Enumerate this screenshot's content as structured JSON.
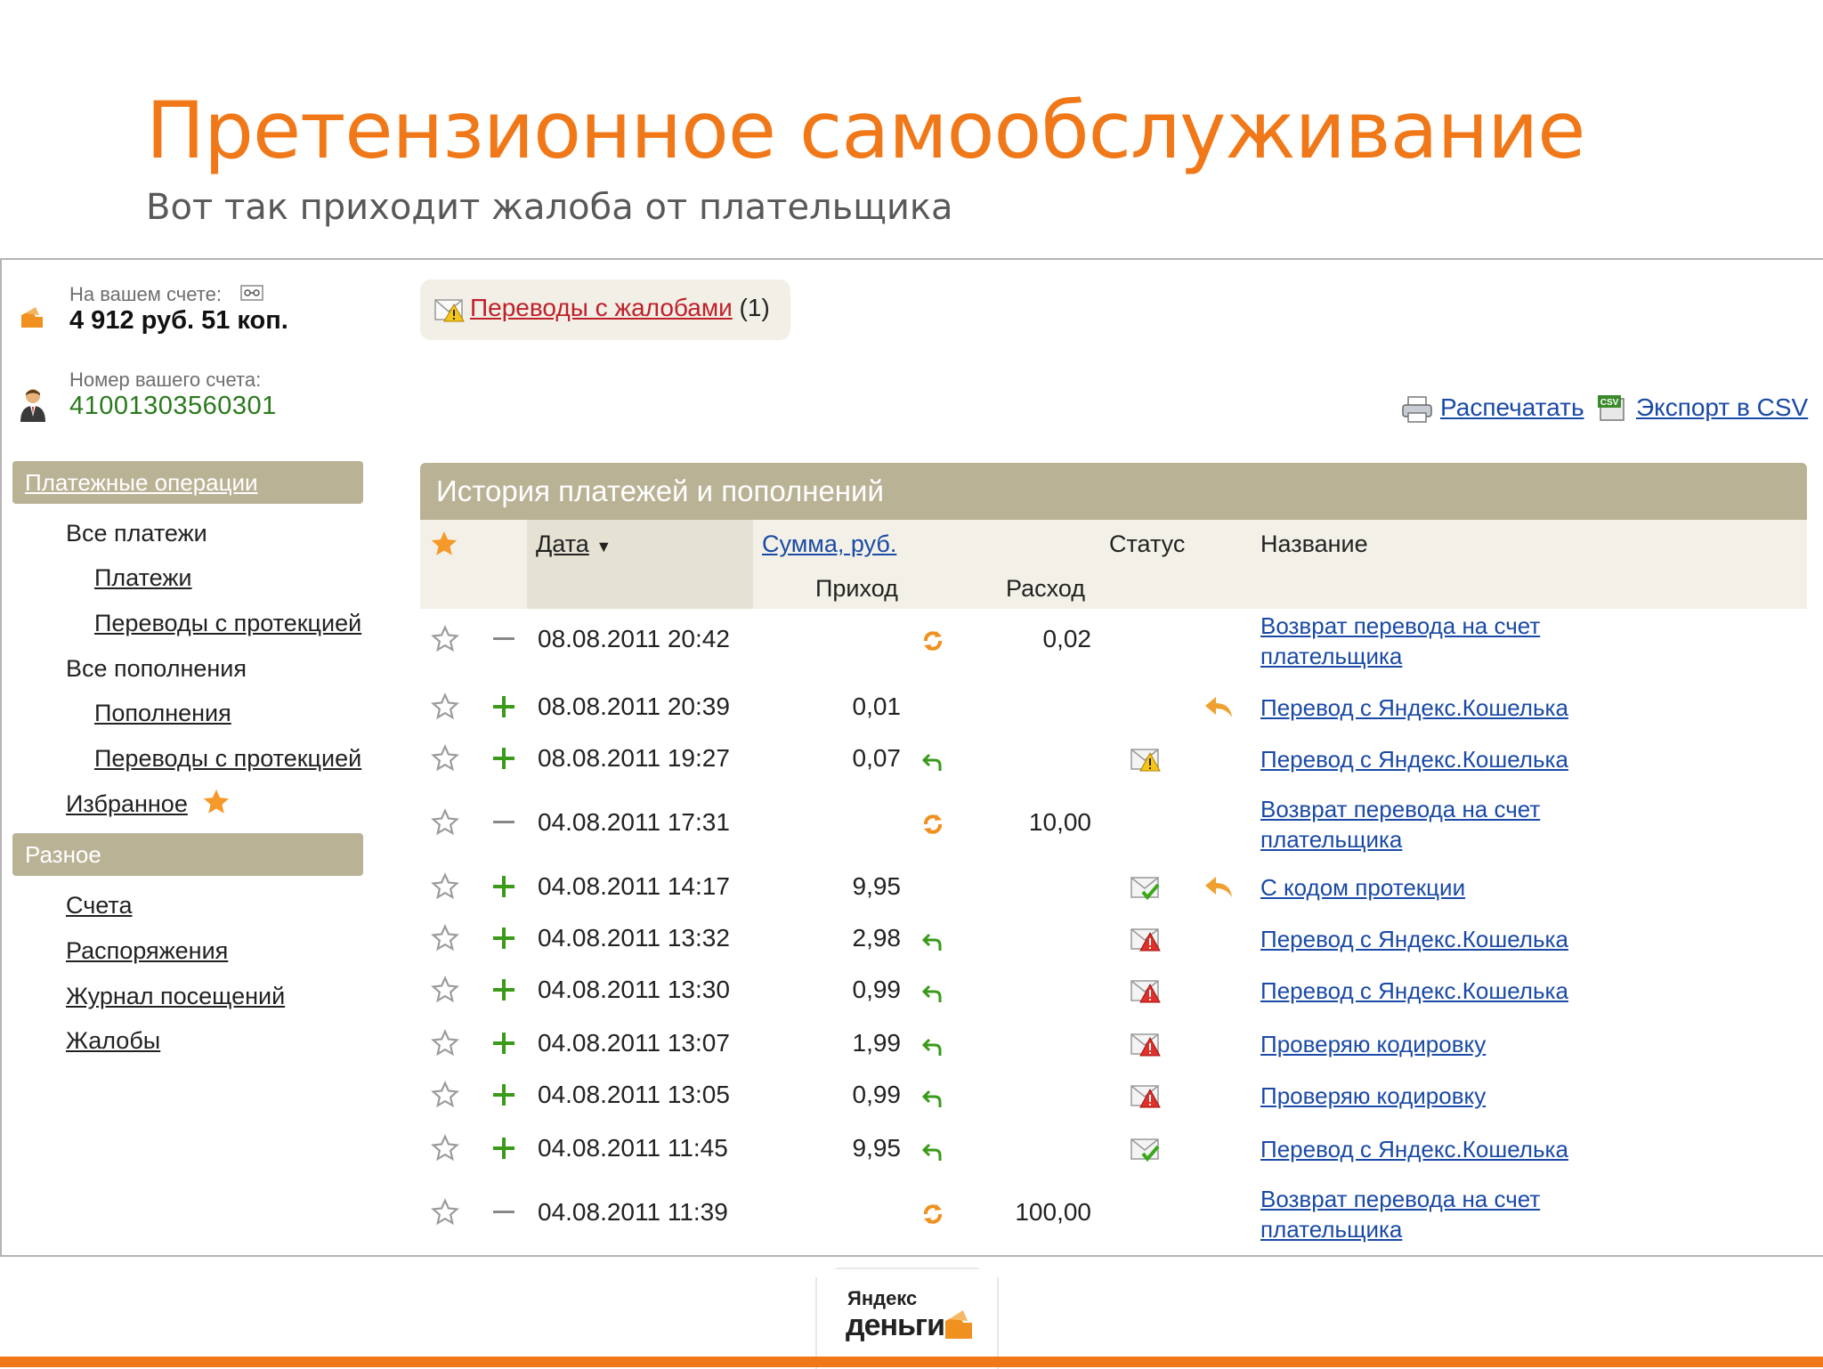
{
  "slide": {
    "title": "Претензионное самообслуживание",
    "subtitle": "Вот так приходит жалоба от плательщика"
  },
  "account": {
    "balance_label": "На вашем счете:",
    "balance": "4 912 руб. 51 коп.",
    "number_label": "Номер вашего счета:",
    "number": "41001303560301"
  },
  "menu": {
    "section1": "Платежные операции",
    "all_payments": "Все платежи",
    "payments": "Платежи",
    "protected1": "Переводы с протекцией",
    "all_topups": "Все пополнения",
    "topups": "Пополнения",
    "protected2": "Переводы с протекцией",
    "favorites": "Избранное",
    "section2": "Разное",
    "accounts": "Счета",
    "orders": "Распоряжения",
    "visits": "Журнал посещений",
    "complaints": "Жалобы"
  },
  "complaints_box": {
    "link": "Переводы с жалобами",
    "count": "(1)"
  },
  "toolbar": {
    "print": "Распечатать",
    "export": "Экспорт в CSV"
  },
  "history": {
    "title": "История платежей и пополнений",
    "col_date": "Дата",
    "sort_arrow": "▼",
    "col_sum": "Сумма, руб.",
    "col_income": "Приход",
    "col_expense": "Расход",
    "col_status": "Статус",
    "col_name": "Название",
    "rows": [
      {
        "sign": "minus",
        "date": "08.08.2011 20:42",
        "income": "",
        "expense": "0,02",
        "refund": "cycle",
        "status": "",
        "arrow": false,
        "name1": "Возврат перевода на счет",
        "name2": "плательщика"
      },
      {
        "sign": "plus",
        "date": "08.08.2011 20:39",
        "income": "0,01",
        "expense": "",
        "refund": "",
        "status": "",
        "arrow": true,
        "name1": "Перевод с Яндекс.Кошелька",
        "name2": ""
      },
      {
        "sign": "plus",
        "date": "08.08.2011 19:27",
        "income": "0,07",
        "expense": "",
        "refund": "back",
        "status": "warn-yellow",
        "arrow": false,
        "name1": "Перевод с Яндекс.Кошелька",
        "name2": ""
      },
      {
        "sign": "minus",
        "date": "04.08.2011 17:31",
        "income": "",
        "expense": "10,00",
        "refund": "cycle",
        "status": "",
        "arrow": false,
        "name1": "Возврат перевода на счет",
        "name2": "плательщика"
      },
      {
        "sign": "plus",
        "date": "04.08.2011 14:17",
        "income": "9,95",
        "expense": "",
        "refund": "",
        "status": "ok",
        "arrow": true,
        "name1": "С кодом протекции",
        "name2": ""
      },
      {
        "sign": "plus",
        "date": "04.08.2011 13:32",
        "income": "2,98",
        "expense": "",
        "refund": "back",
        "status": "warn-red",
        "arrow": false,
        "name1": "Перевод с Яндекс.Кошелька",
        "name2": ""
      },
      {
        "sign": "plus",
        "date": "04.08.2011 13:30",
        "income": "0,99",
        "expense": "",
        "refund": "back",
        "status": "warn-red",
        "arrow": false,
        "name1": "Перевод с Яндекс.Кошелька",
        "name2": ""
      },
      {
        "sign": "plus",
        "date": "04.08.2011 13:07",
        "income": "1,99",
        "expense": "",
        "refund": "back",
        "status": "warn-red",
        "arrow": false,
        "name1": "Проверяю кодировку",
        "name2": ""
      },
      {
        "sign": "plus",
        "date": "04.08.2011 13:05",
        "income": "0,99",
        "expense": "",
        "refund": "back",
        "status": "warn-red",
        "arrow": false,
        "name1": "Проверяю кодировку",
        "name2": ""
      },
      {
        "sign": "plus",
        "date": "04.08.2011 11:45",
        "income": "9,95",
        "expense": "",
        "refund": "back",
        "status": "ok",
        "arrow": false,
        "name1": "Перевод с Яндекс.Кошелька",
        "name2": ""
      },
      {
        "sign": "minus",
        "date": "04.08.2011 11:39",
        "income": "",
        "expense": "100,00",
        "refund": "cycle",
        "status": "",
        "arrow": false,
        "name1": "Возврат перевода на счет",
        "name2": "плательщика"
      }
    ]
  },
  "logo": {
    "top": "Яндекс",
    "bottom": "деньги"
  },
  "colors": {
    "accent": "#f07818",
    "header_bg": "#bab295",
    "link": "#1a4aa6",
    "complaint_link": "#c0202a",
    "account_number": "#2a7a1c"
  }
}
